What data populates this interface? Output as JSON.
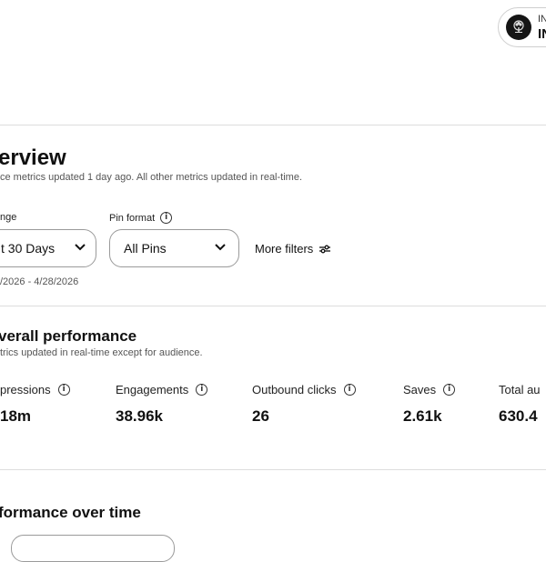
{
  "account": {
    "line1": "IN",
    "line2": "IN",
    "avatar_icon": "tree-logo-icon"
  },
  "overview": {
    "title": "erview",
    "subtitle": "ce metrics updated 1 day ago. All other metrics updated in real-time."
  },
  "filters": {
    "date_range_label": "nge",
    "date_range_value": "t 30 Days",
    "date_range_dates": "/2026 - 4/28/2026",
    "pin_format_label": "Pin format",
    "pin_format_value": "All Pins",
    "more_filters_label": "More filters"
  },
  "overall": {
    "title": "verall performance",
    "subtitle": "trics updated in real-time except for audience.",
    "metrics": [
      {
        "label": "pressions",
        "value": "18m"
      },
      {
        "label": "Engagements",
        "value": "38.96k"
      },
      {
        "label": "Outbound clicks",
        "value": "26"
      },
      {
        "label": "Saves",
        "value": "2.61k"
      },
      {
        "label": "Total au",
        "value": "630.4"
      }
    ]
  },
  "performance_over_time": {
    "title": "formance over time"
  },
  "info_icon_glyph": "i"
}
